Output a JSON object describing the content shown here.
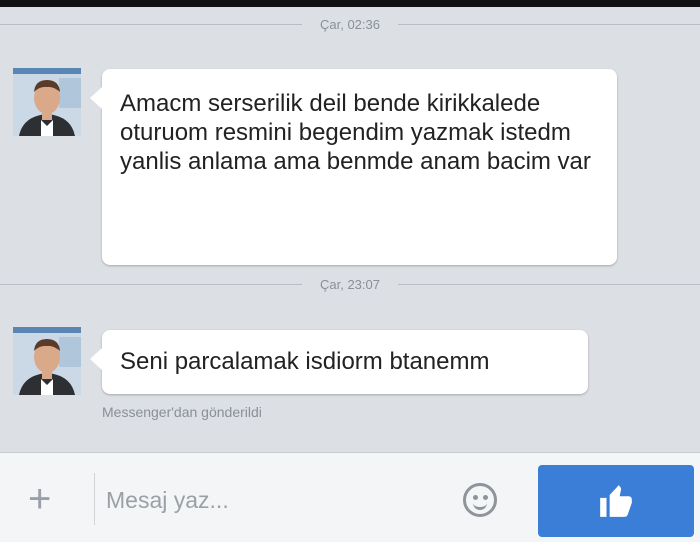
{
  "timestamps": [
    "Çar, 02:36",
    "Çar, 23:07"
  ],
  "messages": [
    {
      "text": "Amacm serserilik deil bende kirikkalede oturuom resmini begendim yazmak istedm yanlis anlama ama benmde anam bacim var"
    },
    {
      "text": "Seni parcalamak isdiorm btanemm"
    }
  ],
  "footer": {
    "sent_from": "Messenger'dan gönderildi"
  },
  "composer": {
    "placeholder": "Mesaj yaz..."
  },
  "colors": {
    "like_button": "#3b7ed8",
    "background": "#dcdfe4"
  },
  "icons": {
    "attach": "plus-icon",
    "emoji": "smiley-icon",
    "like": "thumbs-up-icon"
  }
}
